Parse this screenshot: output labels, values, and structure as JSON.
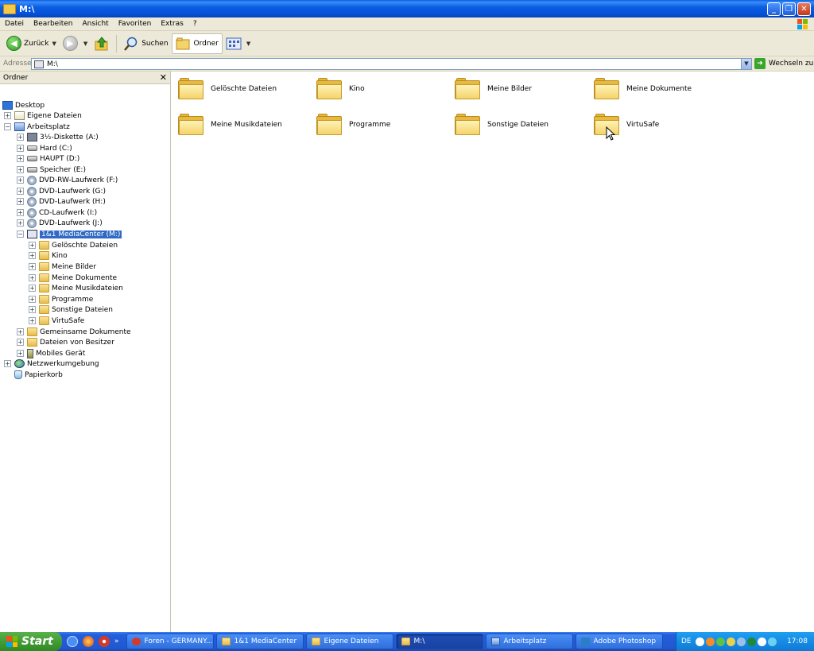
{
  "window": {
    "title": "M:\\"
  },
  "menu": [
    "Datei",
    "Bearbeiten",
    "Ansicht",
    "Favoriten",
    "Extras",
    "?"
  ],
  "toolbar": {
    "back": "Zurück",
    "search": "Suchen",
    "folders": "Ordner"
  },
  "address": {
    "label": "Adresse",
    "value": "M:\\",
    "go": "Wechseln zu"
  },
  "folder_pane": {
    "title": "Ordner",
    "tree": [
      "Desktop",
      "Eigene Dateien",
      "Arbeitsplatz",
      "3½-Diskette (A:)",
      "Hard (C:)",
      "HAUPT (D:)",
      "Speicher (E:)",
      "DVD-RW-Laufwerk (F:)",
      "DVD-Laufwerk (G:)",
      "DVD-Laufwerk (H:)",
      "CD-Laufwerk (I:)",
      "DVD-Laufwerk (J:)",
      "1&1 MediaCenter (M:)",
      "Gelöschte Dateien",
      "Kino",
      "Meine Bilder",
      "Meine Dokumente",
      "Meine Musikdateien",
      "Programme",
      "Sonstige Dateien",
      "VirtuSafe",
      "Gemeinsame Dokumente",
      "Dateien von Besitzer",
      "Mobiles Gerät",
      "Netzwerkumgebung",
      "Papierkorb"
    ]
  },
  "content_folders": [
    "Gelöschte Dateien",
    "Kino",
    "Meine Bilder",
    "Meine Dokumente",
    "Meine Musikdateien",
    "Programme",
    "Sonstige Dateien",
    "VirtuSafe"
  ],
  "taskbar": {
    "start": "Start",
    "tasks": [
      "Foren - GERMANY...",
      "1&1 MediaCenter",
      "Eigene Dateien",
      "M:\\",
      "Arbeitsplatz",
      "Adobe Photoshop"
    ],
    "language": "DE",
    "clock": "17:08"
  }
}
